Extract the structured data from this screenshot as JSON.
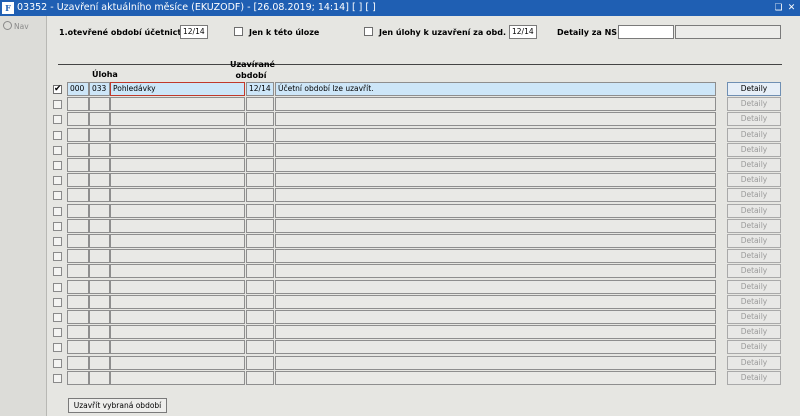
{
  "window": {
    "app_icon": "F",
    "title": "03352 - Uzavření aktuálního měsíce (EKUZODF) - [26.08.2019; 14:14]  [ ]  [ ]",
    "restore_icon": "restore-window-icon",
    "close_icon": "close-icon"
  },
  "nav": {
    "label": "Nav",
    "icon": "nav-icon"
  },
  "header": {
    "period_label": "1.otevřené období účetnictví",
    "period_value": "12/14",
    "only_task_label": "Jen k této úloze",
    "only_task_checked": false,
    "only_closable_label": "Jen úlohy k uzavření za obd.",
    "only_closable_checked": false,
    "only_closable_value": "12/14",
    "details_ns_label": "Detaily za NS",
    "details_ns_value": "",
    "details_ns_value2": ""
  },
  "columns": {
    "task": "Úloha",
    "closing_period": "Uzavírané období"
  },
  "rows": [
    {
      "checked": true,
      "code1": "000",
      "code2": "033",
      "task": "Pohledávky",
      "period": "12/14",
      "message": "Účetní období lze uzavřít.",
      "details": "Detaily",
      "enabled": true
    },
    {
      "checked": false,
      "code1": "",
      "code2": "",
      "task": "",
      "period": "",
      "message": "",
      "details": "Detaily",
      "enabled": false
    },
    {
      "checked": false,
      "code1": "",
      "code2": "",
      "task": "",
      "period": "",
      "message": "",
      "details": "Detaily",
      "enabled": false
    },
    {
      "checked": false,
      "code1": "",
      "code2": "",
      "task": "",
      "period": "",
      "message": "",
      "details": "Detaily",
      "enabled": false
    },
    {
      "checked": false,
      "code1": "",
      "code2": "",
      "task": "",
      "period": "",
      "message": "",
      "details": "Detaily",
      "enabled": false
    },
    {
      "checked": false,
      "code1": "",
      "code2": "",
      "task": "",
      "period": "",
      "message": "",
      "details": "Detaily",
      "enabled": false
    },
    {
      "checked": false,
      "code1": "",
      "code2": "",
      "task": "",
      "period": "",
      "message": "",
      "details": "Detaily",
      "enabled": false
    },
    {
      "checked": false,
      "code1": "",
      "code2": "",
      "task": "",
      "period": "",
      "message": "",
      "details": "Detaily",
      "enabled": false
    },
    {
      "checked": false,
      "code1": "",
      "code2": "",
      "task": "",
      "period": "",
      "message": "",
      "details": "Detaily",
      "enabled": false
    },
    {
      "checked": false,
      "code1": "",
      "code2": "",
      "task": "",
      "period": "",
      "message": "",
      "details": "Detaily",
      "enabled": false
    },
    {
      "checked": false,
      "code1": "",
      "code2": "",
      "task": "",
      "period": "",
      "message": "",
      "details": "Detaily",
      "enabled": false
    },
    {
      "checked": false,
      "code1": "",
      "code2": "",
      "task": "",
      "period": "",
      "message": "",
      "details": "Detaily",
      "enabled": false
    },
    {
      "checked": false,
      "code1": "",
      "code2": "",
      "task": "",
      "period": "",
      "message": "",
      "details": "Detaily",
      "enabled": false
    },
    {
      "checked": false,
      "code1": "",
      "code2": "",
      "task": "",
      "period": "",
      "message": "",
      "details": "Detaily",
      "enabled": false
    },
    {
      "checked": false,
      "code1": "",
      "code2": "",
      "task": "",
      "period": "",
      "message": "",
      "details": "Detaily",
      "enabled": false
    },
    {
      "checked": false,
      "code1": "",
      "code2": "",
      "task": "",
      "period": "",
      "message": "",
      "details": "Detaily",
      "enabled": false
    },
    {
      "checked": false,
      "code1": "",
      "code2": "",
      "task": "",
      "period": "",
      "message": "",
      "details": "Detaily",
      "enabled": false
    },
    {
      "checked": false,
      "code1": "",
      "code2": "",
      "task": "",
      "period": "",
      "message": "",
      "details": "Detaily",
      "enabled": false
    },
    {
      "checked": false,
      "code1": "",
      "code2": "",
      "task": "",
      "period": "",
      "message": "",
      "details": "Detaily",
      "enabled": false
    },
    {
      "checked": false,
      "code1": "",
      "code2": "",
      "task": "",
      "period": "",
      "message": "",
      "details": "Detaily",
      "enabled": false
    }
  ],
  "footer": {
    "close_button": "Uzavřít vybraná období"
  },
  "colors": {
    "titlebar": "#1f5fb3",
    "selected_row": "#cde6f8",
    "focus_border": "#c0392b"
  }
}
